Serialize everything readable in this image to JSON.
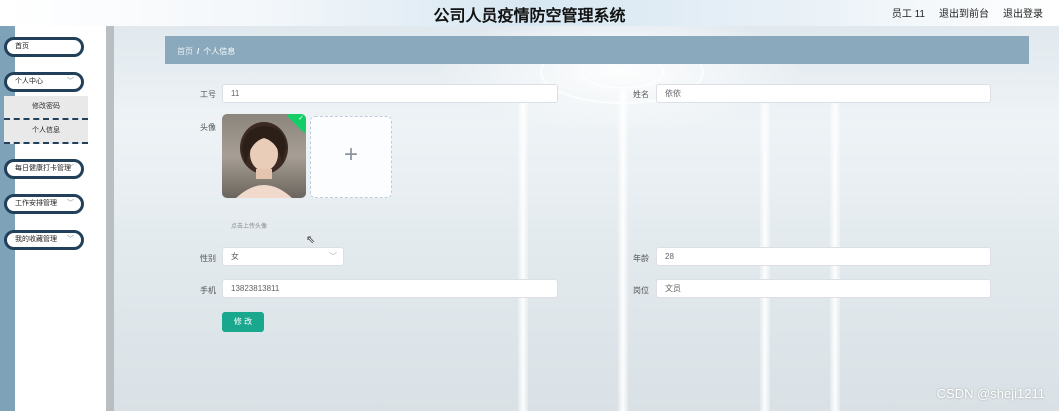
{
  "header": {
    "title": "公司人员疫情防空管理系统",
    "user": "员工 11",
    "back_to_front": "退出到前台",
    "logout": "退出登录"
  },
  "sidebar": {
    "home": "首页",
    "personal_center": "个人中心",
    "submenu": [
      "修改密码",
      "个人信息"
    ],
    "items": [
      "每日健康打卡管理",
      "工作安排管理",
      "我的收藏管理"
    ]
  },
  "breadcrumb": {
    "home": "首页",
    "separator": "/",
    "current": "个人信息"
  },
  "form": {
    "id_label": "工号",
    "id_value": "11",
    "name_label": "姓名",
    "name_value": "依依",
    "avatar_label": "头像",
    "upload_plus": "+",
    "upload_tip": "点击上传头像",
    "gender_label": "性别",
    "gender_value": "女",
    "age_label": "年龄",
    "age_value": "28",
    "phone_label": "手机",
    "phone_value": "13823813811",
    "post_label": "岗位",
    "post_value": "文员",
    "submit_label": "修 改"
  },
  "watermark": "CSDN @sheji1211",
  "colors": {
    "primary_button": "#19a78d",
    "breadcrumb_bar": "#8aa9bc",
    "menu_border": "#22405a",
    "upload_success": "#13ce66"
  },
  "icons": {
    "dropdown": "chevron-down-icon",
    "upload": "plus-icon",
    "uploaded": "check-icon",
    "cursor": "mouse-cursor-icon"
  }
}
